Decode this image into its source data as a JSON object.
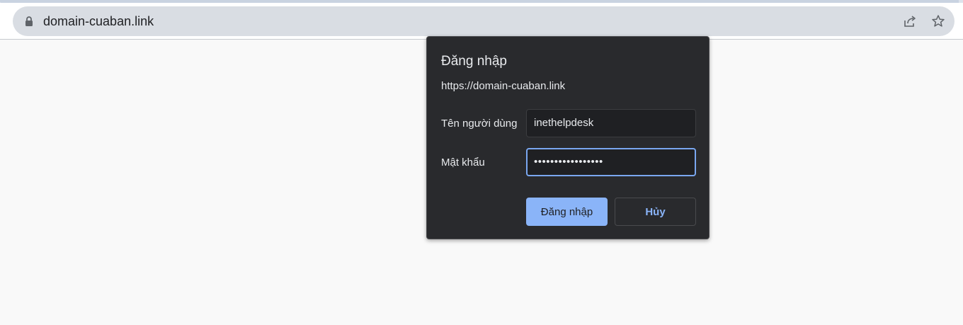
{
  "browser": {
    "url": "domain-cuaban.link",
    "lock_icon": "lock-icon",
    "share_icon": "share-icon",
    "star_icon": "star-icon"
  },
  "auth_dialog": {
    "title": "Đăng nhập",
    "origin": "https://domain-cuaban.link",
    "username_label": "Tên người dùng",
    "username_value": "inethelpdesk",
    "password_label": "Mật khẩu",
    "password_value": "•••••••••••••••••",
    "login_button": "Đăng nhập",
    "cancel_button": "Hủy"
  },
  "colors": {
    "dialog_bg": "#292a2d",
    "accent": "#8ab4f8",
    "focus_border": "#7aa7f0"
  }
}
